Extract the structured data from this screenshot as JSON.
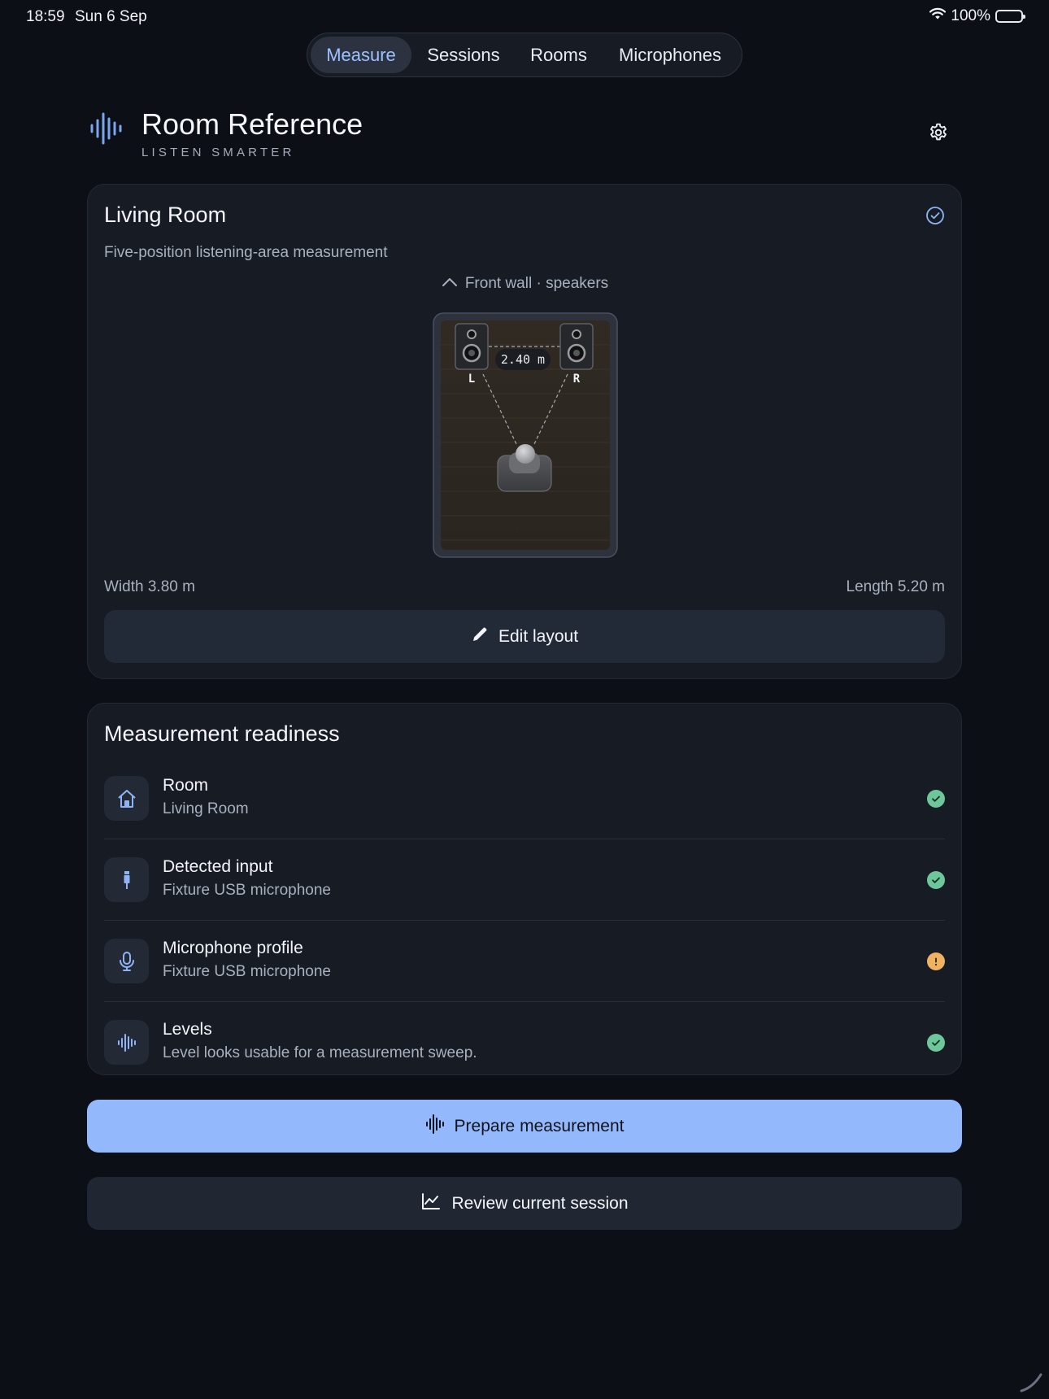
{
  "status_bar": {
    "time": "18:59",
    "date": "Sun 6 Sep",
    "battery": "100%"
  },
  "tabs": [
    {
      "label": "Measure",
      "active": true
    },
    {
      "label": "Sessions",
      "active": false
    },
    {
      "label": "Rooms",
      "active": false
    },
    {
      "label": "Microphones",
      "active": false
    }
  ],
  "brand": {
    "title": "Room Reference",
    "subtitle": "LISTEN SMARTER",
    "icon": "waveform-icon"
  },
  "room_card": {
    "title": "Living Room",
    "description": "Five-position listening-area measurement",
    "front_wall": "Front wall · speakers",
    "speaker_left": "L",
    "speaker_right": "R",
    "speaker_distance": "2.40 m",
    "width": "Width 3.80 m",
    "length": "Length 5.20 m",
    "edit_label": "Edit layout"
  },
  "readiness": {
    "title": "Measurement readiness",
    "items": [
      {
        "title": "Room",
        "subtitle": "Living Room",
        "icon": "house-icon",
        "status": "ok"
      },
      {
        "title": "Detected input",
        "subtitle": "Fixture USB microphone",
        "icon": "usb-plug-icon",
        "status": "ok"
      },
      {
        "title": "Microphone profile",
        "subtitle": "Fixture USB microphone",
        "icon": "microphone-icon",
        "status": "warning"
      },
      {
        "title": "Levels",
        "subtitle": "Level looks usable for a measurement sweep.",
        "icon": "waveform-icon",
        "status": "ok"
      }
    ]
  },
  "actions": {
    "primary": "Prepare measurement",
    "secondary": "Review current session"
  },
  "colors": {
    "background": "#0c0f16",
    "card": "#161b24",
    "accent": "#93b8fc",
    "ok": "#6dc79a",
    "warning": "#efb262"
  }
}
